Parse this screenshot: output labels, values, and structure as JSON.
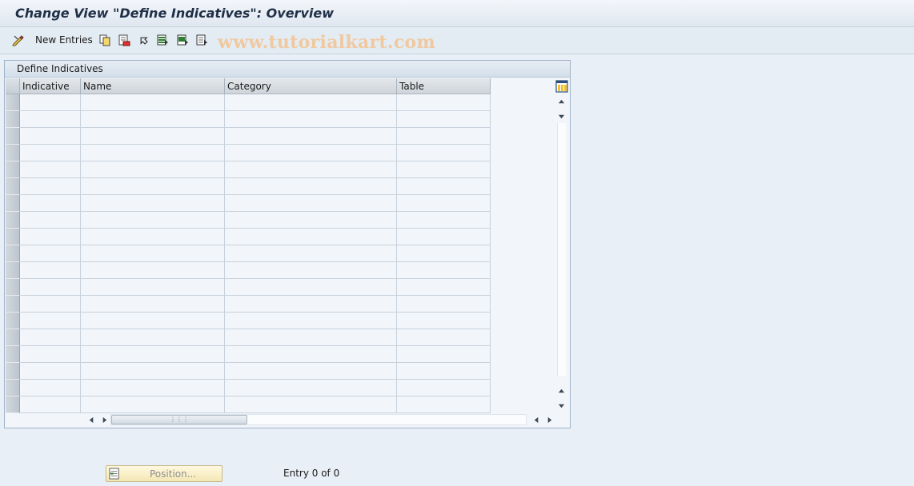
{
  "title": "Change View \"Define Indicatives\": Overview",
  "toolbar": {
    "new_entries_label": "New Entries",
    "watermark": "www.tutorialkart.com",
    "icons": [
      "edit-pencil-icon",
      "copy-icon",
      "delete-icon",
      "undo-icon",
      "select-all-icon",
      "select-block-icon",
      "deselect-all-icon"
    ]
  },
  "panel": {
    "header": "Define Indicatives",
    "columns": [
      "Indicative",
      "Name",
      "Category",
      "Table"
    ],
    "row_count": 19,
    "rows": []
  },
  "footer": {
    "position_label": "Position...",
    "entry_text": "Entry 0 of 0"
  },
  "colors": {
    "background": "#e9eff6",
    "panel_border": "#9fb3c7",
    "position_button": "#f4e7b5",
    "watermark": "#f0c9a0"
  }
}
